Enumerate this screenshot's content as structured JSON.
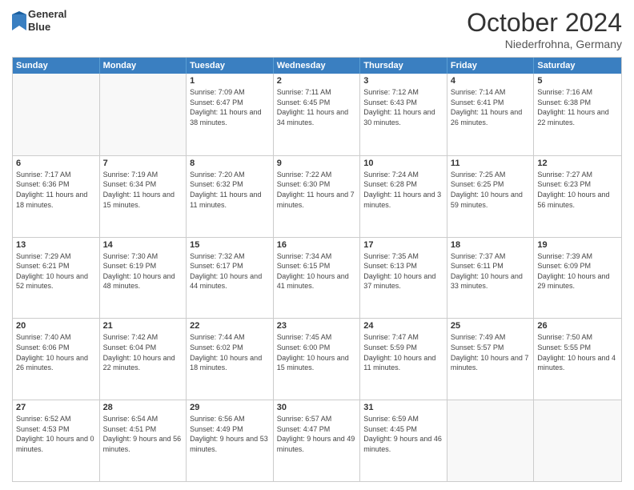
{
  "header": {
    "logo_line1": "General",
    "logo_line2": "Blue",
    "month": "October 2024",
    "location": "Niederfrohna, Germany"
  },
  "days": [
    "Sunday",
    "Monday",
    "Tuesday",
    "Wednesday",
    "Thursday",
    "Friday",
    "Saturday"
  ],
  "weeks": [
    [
      {
        "day": "",
        "detail": ""
      },
      {
        "day": "",
        "detail": ""
      },
      {
        "day": "1",
        "detail": "Sunrise: 7:09 AM\nSunset: 6:47 PM\nDaylight: 11 hours and 38 minutes."
      },
      {
        "day": "2",
        "detail": "Sunrise: 7:11 AM\nSunset: 6:45 PM\nDaylight: 11 hours and 34 minutes."
      },
      {
        "day": "3",
        "detail": "Sunrise: 7:12 AM\nSunset: 6:43 PM\nDaylight: 11 hours and 30 minutes."
      },
      {
        "day": "4",
        "detail": "Sunrise: 7:14 AM\nSunset: 6:41 PM\nDaylight: 11 hours and 26 minutes."
      },
      {
        "day": "5",
        "detail": "Sunrise: 7:16 AM\nSunset: 6:38 PM\nDaylight: 11 hours and 22 minutes."
      }
    ],
    [
      {
        "day": "6",
        "detail": "Sunrise: 7:17 AM\nSunset: 6:36 PM\nDaylight: 11 hours and 18 minutes."
      },
      {
        "day": "7",
        "detail": "Sunrise: 7:19 AM\nSunset: 6:34 PM\nDaylight: 11 hours and 15 minutes."
      },
      {
        "day": "8",
        "detail": "Sunrise: 7:20 AM\nSunset: 6:32 PM\nDaylight: 11 hours and 11 minutes."
      },
      {
        "day": "9",
        "detail": "Sunrise: 7:22 AM\nSunset: 6:30 PM\nDaylight: 11 hours and 7 minutes."
      },
      {
        "day": "10",
        "detail": "Sunrise: 7:24 AM\nSunset: 6:28 PM\nDaylight: 11 hours and 3 minutes."
      },
      {
        "day": "11",
        "detail": "Sunrise: 7:25 AM\nSunset: 6:25 PM\nDaylight: 10 hours and 59 minutes."
      },
      {
        "day": "12",
        "detail": "Sunrise: 7:27 AM\nSunset: 6:23 PM\nDaylight: 10 hours and 56 minutes."
      }
    ],
    [
      {
        "day": "13",
        "detail": "Sunrise: 7:29 AM\nSunset: 6:21 PM\nDaylight: 10 hours and 52 minutes."
      },
      {
        "day": "14",
        "detail": "Sunrise: 7:30 AM\nSunset: 6:19 PM\nDaylight: 10 hours and 48 minutes."
      },
      {
        "day": "15",
        "detail": "Sunrise: 7:32 AM\nSunset: 6:17 PM\nDaylight: 10 hours and 44 minutes."
      },
      {
        "day": "16",
        "detail": "Sunrise: 7:34 AM\nSunset: 6:15 PM\nDaylight: 10 hours and 41 minutes."
      },
      {
        "day": "17",
        "detail": "Sunrise: 7:35 AM\nSunset: 6:13 PM\nDaylight: 10 hours and 37 minutes."
      },
      {
        "day": "18",
        "detail": "Sunrise: 7:37 AM\nSunset: 6:11 PM\nDaylight: 10 hours and 33 minutes."
      },
      {
        "day": "19",
        "detail": "Sunrise: 7:39 AM\nSunset: 6:09 PM\nDaylight: 10 hours and 29 minutes."
      }
    ],
    [
      {
        "day": "20",
        "detail": "Sunrise: 7:40 AM\nSunset: 6:06 PM\nDaylight: 10 hours and 26 minutes."
      },
      {
        "day": "21",
        "detail": "Sunrise: 7:42 AM\nSunset: 6:04 PM\nDaylight: 10 hours and 22 minutes."
      },
      {
        "day": "22",
        "detail": "Sunrise: 7:44 AM\nSunset: 6:02 PM\nDaylight: 10 hours and 18 minutes."
      },
      {
        "day": "23",
        "detail": "Sunrise: 7:45 AM\nSunset: 6:00 PM\nDaylight: 10 hours and 15 minutes."
      },
      {
        "day": "24",
        "detail": "Sunrise: 7:47 AM\nSunset: 5:59 PM\nDaylight: 10 hours and 11 minutes."
      },
      {
        "day": "25",
        "detail": "Sunrise: 7:49 AM\nSunset: 5:57 PM\nDaylight: 10 hours and 7 minutes."
      },
      {
        "day": "26",
        "detail": "Sunrise: 7:50 AM\nSunset: 5:55 PM\nDaylight: 10 hours and 4 minutes."
      }
    ],
    [
      {
        "day": "27",
        "detail": "Sunrise: 6:52 AM\nSunset: 4:53 PM\nDaylight: 10 hours and 0 minutes."
      },
      {
        "day": "28",
        "detail": "Sunrise: 6:54 AM\nSunset: 4:51 PM\nDaylight: 9 hours and 56 minutes."
      },
      {
        "day": "29",
        "detail": "Sunrise: 6:56 AM\nSunset: 4:49 PM\nDaylight: 9 hours and 53 minutes."
      },
      {
        "day": "30",
        "detail": "Sunrise: 6:57 AM\nSunset: 4:47 PM\nDaylight: 9 hours and 49 minutes."
      },
      {
        "day": "31",
        "detail": "Sunrise: 6:59 AM\nSunset: 4:45 PM\nDaylight: 9 hours and 46 minutes."
      },
      {
        "day": "",
        "detail": ""
      },
      {
        "day": "",
        "detail": ""
      }
    ]
  ]
}
